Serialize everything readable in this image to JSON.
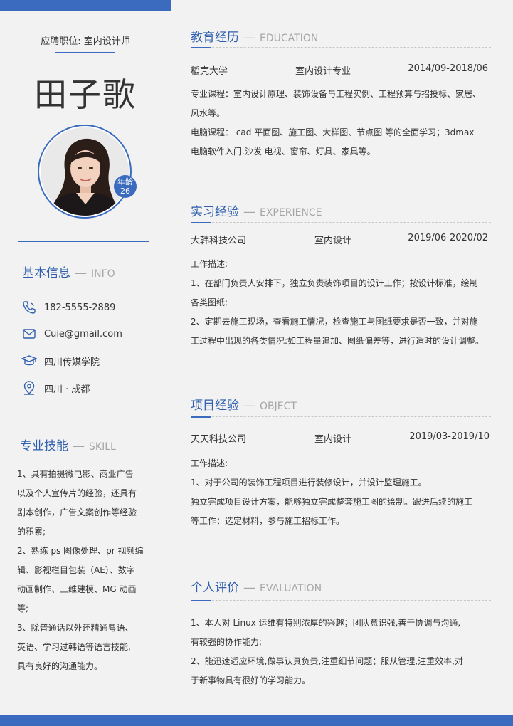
{
  "left": {
    "job": "应聘职位: 室内设计师",
    "name": "田子歌",
    "age_label": "年龄",
    "age_value": "26",
    "info": {
      "title": "基本信息",
      "subtitle": "INFO",
      "phone": "182-5555-2889",
      "email": "Cuie@gmail.com",
      "school": "四川传媒学院",
      "location": "四川 · 成都"
    },
    "skills": {
      "title": "专业技能",
      "subtitle": "SKILL",
      "lines": [
        "1、具有拍摄微电影、商业广告",
        "以及个人宣传片的经验，还具有",
        "剧本创作，广告文案创作等经验",
        "的积累;",
        "2、熟练 ps 图像处理、pr 视频编",
        "辑、影视栏目包装（AE）、数字",
        "动画制作、三维建模、MG 动画",
        "等;",
        "3、除普通话以外还精通粤语、",
        "英语、学习过韩语等语言技能,",
        "具有良好的沟通能力。"
      ]
    }
  },
  "education": {
    "title": "教育经历",
    "subtitle": "EDUCATION",
    "school": "稻壳大学",
    "major": "室内设计专业",
    "period": "2014/09-2018/06",
    "lines": [
      "专业课程：室内设计原理、装饰设备与工程实例、工程预算与招投标、家居、",
      "风水等。",
      "电脑课程： cad 平面图、施工图、大样图、节点图 等的全面学习；3dmax",
      "电脑软件入门.沙发 电视、窗帘、灯具、家具等。"
    ]
  },
  "internship": {
    "title": "实习经验",
    "subtitle": "EXPERIENCE",
    "company": "大韩科技公司",
    "role": "室内设计",
    "period": "2019/06-2020/02",
    "lines": [
      "工作描述:",
      "1、在部门负责人安排下，独立负责装饰项目的设计工作；按设计标准，绘制",
      "各类图纸;",
      "2、定期去施工现场，查看施工情况，检查施工与图纸要求是否一致，并对施",
      "工过程中出现的各类情况:如工程量追加、图纸偏差等，进行适时的设计调整。"
    ]
  },
  "project": {
    "title": "项目经验",
    "subtitle": "OBJECT",
    "company": "天天科技公司",
    "role": "室内设计",
    "period": "2019/03-2019/10",
    "lines": [
      "工作描述:",
      "1、对于公司的装饰工程项目进行装修设计，并设计监理施工。",
      "独立完成项目设计方案，能够独立完成整套施工图的绘制。跟进后续的施工",
      "等工作：选定材料，参与施工招标工作。"
    ]
  },
  "evaluation": {
    "title": "个人评价",
    "subtitle": "EVALUATION",
    "lines": [
      "1、本人对 Linux 运维有特别浓厚的兴趣；团队意识强,善于协调与沟通,",
      "有较强的协作能力;",
      "2、能迅速适应环境,做事认真负责,注重细节问题；服从管理,注重效率,对",
      "于新事物具有很好的学习能力。"
    ]
  },
  "colors": {
    "accent": "#3a6bbf",
    "title_blue": "#2f5fae",
    "background": "#f2f2f2"
  },
  "icons": [
    "phone-icon",
    "mail-icon",
    "graduation-cap-icon",
    "location-pin-icon"
  ]
}
